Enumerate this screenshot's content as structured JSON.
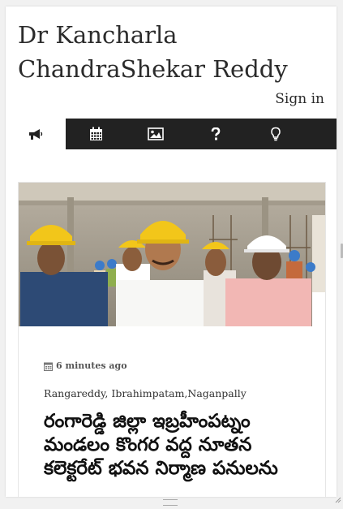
{
  "site": {
    "title": "Dr Kancharla ChandraShekar Reddy"
  },
  "header": {
    "signin_label": "Sign in"
  },
  "nav": {
    "items": [
      {
        "icon": "megaphone-icon",
        "active": true
      },
      {
        "icon": "calendar-icon",
        "active": false
      },
      {
        "icon": "image-icon",
        "active": false
      },
      {
        "icon": "question-icon",
        "active": false
      },
      {
        "icon": "lightbulb-icon",
        "active": false
      }
    ],
    "colors": {
      "bar": "#222222",
      "active": "#ffffff"
    }
  },
  "post": {
    "time": "6 minutes ago",
    "location": "Rangareddy, Ibrahimpatam,Naganpally",
    "headline": "రంగారెడ్డి జిల్లా ఇబ్రహీంపట్నం మండలం కొంగర వద్ద నూతన కలెక్టరేట్ భవన నిర్మాణ పనులను"
  }
}
